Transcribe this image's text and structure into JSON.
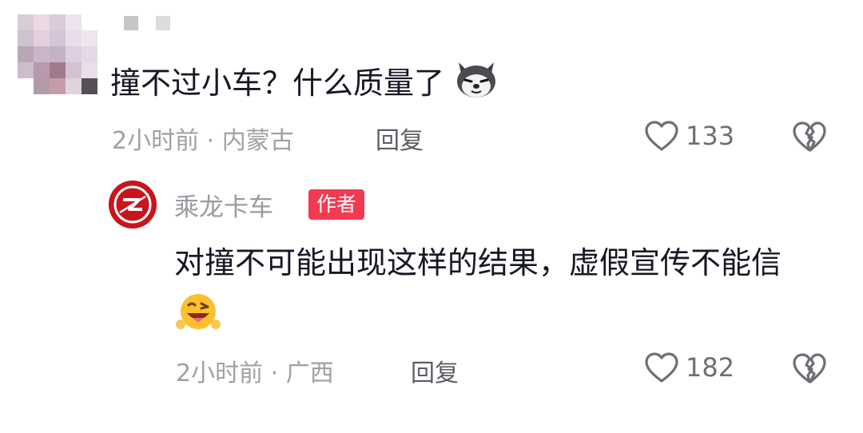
{
  "comment": {
    "text": "撞不过小车？什么质量了",
    "emoji": "husky-dog-emoji",
    "time": "2小时前",
    "sep": "·",
    "location": "内蒙古",
    "reply_label": "回复",
    "likes": "133"
  },
  "reply": {
    "username": "乘龙卡车",
    "badge": "作者",
    "text": "对撞不可能出现这样的结果，虚假宣传不能信",
    "emoji": "winking-tongue-emoji",
    "time": "2小时前",
    "sep": "·",
    "location": "广西",
    "reply_label": "回复",
    "likes": "182"
  },
  "colors": {
    "text_primary": "#161823",
    "meta": "#a0a0a6",
    "badge_bg": "#f23b52",
    "brand_red": "#c9141b"
  }
}
